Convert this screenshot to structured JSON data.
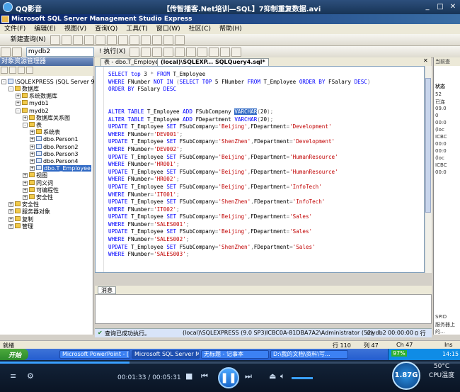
{
  "player": {
    "app_name": "QQ影音",
    "video_title": "【传智播客.Net培训—SQL】7抑制重复数据.avi",
    "time_current": "00:01:33",
    "time_total": "00:05:31",
    "speed": "1.87G",
    "cpu_temp": "50°C",
    "cpu_label": "CPU温度"
  },
  "window": {
    "title": "Microsoft SQL Server Management Studio Express"
  },
  "menu": [
    "文件(F)",
    "编辑(E)",
    "视图(V)",
    "查询(Q)",
    "工具(T)",
    "窗口(W)",
    "社区(C)",
    "帮助(H)"
  ],
  "toolbar": {
    "new_query": "新建查询(N)",
    "database": "mydb2",
    "execute": "执行(X)"
  },
  "object_explorer": {
    "title": "对象资源管理器",
    "server": "\\SQLEXPRESS (SQL Server 9.0...",
    "nodes": [
      {
        "label": "数据库",
        "indent": 1
      },
      {
        "label": "系统数据库",
        "indent": 2
      },
      {
        "label": "mydb1",
        "indent": 2
      },
      {
        "label": "mydb2",
        "indent": 2
      },
      {
        "label": "数据库关系图",
        "indent": 3
      },
      {
        "label": "表",
        "indent": 3
      },
      {
        "label": "系统表",
        "indent": 4
      },
      {
        "label": "dbo.Person1",
        "indent": 4
      },
      {
        "label": "dbo.Person2",
        "indent": 4
      },
      {
        "label": "dbo.Person3",
        "indent": 4
      },
      {
        "label": "dbo.Person4",
        "indent": 4
      },
      {
        "label": "dbo.T_Employee",
        "indent": 4
      },
      {
        "label": "视图",
        "indent": 3
      },
      {
        "label": "同义词",
        "indent": 3
      },
      {
        "label": "可编程性",
        "indent": 3
      },
      {
        "label": "安全性",
        "indent": 3
      },
      {
        "label": "安全性",
        "indent": 1
      },
      {
        "label": "服务器对象",
        "indent": 1
      },
      {
        "label": "复制",
        "indent": 1
      },
      {
        "label": "管理",
        "indent": 1
      }
    ]
  },
  "tabs": [
    "表 - dbo.T_Employee",
    "(local)\\SQLEXP... SQLQuery4.sql*"
  ],
  "code": [
    "SELECT top 3 * FROM T_Employee",
    "WHERE FNumber NOT IN (SELECT TOP 5 FNumber FROM T_Employee ORDER BY FSalary DESC)",
    "ORDER BY FSalary DESC",
    "",
    "",
    "ALTER TABLE T_Employee ADD FSubCompany VARCHAR(20);",
    "ALTER TABLE T_Employee ADD FDepartment VARCHAR(20);",
    "UPDATE T_Employee SET FSubCompany='Beijing',FDepartment='Development'",
    "WHERE FNumber='DEV001';",
    "UPDATE T_Employee SET FSubCompany='ShenZhen',FDepartment='Development'",
    "WHERE FNumber='DEV002';",
    "UPDATE T_Employee SET FSubCompany='Beijing',FDepartment='HumanResource'",
    "WHERE FNumber='HR001';",
    "UPDATE T_Employee SET FSubCompany='Beijing',FDepartment='HumanResource'",
    "WHERE FNumber='HR002';",
    "UPDATE T_Employee SET FSubCompany='Beijing',FDepartment='InfoTech'",
    "WHERE FNumber='IT001';",
    "UPDATE T_Employee SET FSubCompany='ShenZhen',FDepartment='InfoTech'",
    "WHERE FNumber='IT002';",
    "UPDATE T_Employee SET FSubCompany='Beijing',FDepartment='Sales'",
    "WHERE FNumber='SALES001';",
    "UPDATE T_Employee SET FSubCompany='Beijing',FDepartment='Sales'",
    "WHERE FNumber='SALES002';",
    "UPDATE T_Employee SET FSubCompany='ShenZhen',FDepartment='Sales'",
    "WHERE FNumber='SALES003';"
  ],
  "results": {
    "tab": "消息"
  },
  "query_status": {
    "message": "查询已成功执行。",
    "server": "(local)\\SQLEXPRESS (9.0 SP3)",
    "user": "ICBC0A-81DBA7A2\\Administrator (52)",
    "db": "mydb2",
    "elapsed": "00:00:00",
    "rows": "0 行"
  },
  "statusbar": {
    "ready": "就绪",
    "line": "行 110",
    "col": "列 47",
    "ch": "Ch 47",
    "ins": "Ins"
  },
  "properties": {
    "header": "当前查",
    "section": "状态",
    "values": [
      "52",
      "已连",
      "09.0",
      "0",
      "00:0",
      "(loc",
      "ICBC",
      "00:0",
      "00:0",
      "(loc",
      "ICBC",
      "00:0"
    ],
    "spid": "SPID",
    "footer": "服务器上的..."
  },
  "taskbar": {
    "start": "开始",
    "items": [
      "Microsoft PowerPoint - [..",
      "Microsoft SQL Server M...",
      "无标题 - 记事本",
      "D:\\我的文档\\资料\\写..."
    ],
    "battery": "97%",
    "clock": "14:15"
  },
  "colors": {
    "keyword": "#0000ff",
    "string": "#c00000",
    "selection": "#316ac5"
  }
}
